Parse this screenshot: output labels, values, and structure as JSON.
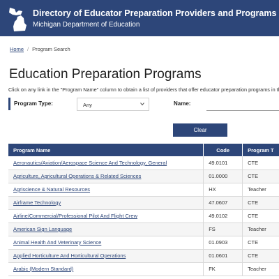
{
  "header": {
    "title": "Directory of Educator Preparation Providers and Programs",
    "subtitle": "Michigan Department of Education",
    "logo_icon": "michigan-state-icon",
    "bg_color": "#2d4679"
  },
  "breadcrumb": {
    "home": "Home",
    "separator": "/",
    "current": "Program Search"
  },
  "page": {
    "title": "Education Preparation Programs",
    "intro": "Click on any link in the \"Program Name\" column to obtain a list of providers that offer educator preparation programs in tha"
  },
  "filters": {
    "program_type_label": "Program Type:",
    "program_type_value": "Any",
    "name_label": "Name:",
    "name_value": "",
    "clear_label": "Clear"
  },
  "table": {
    "headers": [
      "Program Name",
      "Code",
      "Program T"
    ],
    "rows": [
      {
        "name": "Aeronautics/Aviation/Aerospace Science And Technology, General",
        "code": "49.0101",
        "type": "CTE"
      },
      {
        "name": "Agriculture, Agricultural Operations & Related Sciences",
        "code": "01.0000",
        "type": "CTE"
      },
      {
        "name": "Agriscience & Natural Resources",
        "code": "HX",
        "type": "Teacher"
      },
      {
        "name": "Airframe Technology",
        "code": "47.0607",
        "type": "CTE"
      },
      {
        "name": "Airline/Commercial/Professional Pilot And Flight Crew",
        "code": "49.0102",
        "type": "CTE"
      },
      {
        "name": "American Sign Language",
        "code": "FS",
        "type": "Teacher"
      },
      {
        "name": "Animal Health And Veterinary Science",
        "code": "01.0903",
        "type": "CTE"
      },
      {
        "name": "Applied Horticulture And Horticultural Operations",
        "code": "01.0601",
        "type": "CTE"
      },
      {
        "name": "Arabic (Modern Standard)",
        "code": "FK",
        "type": "Teacher"
      }
    ]
  }
}
